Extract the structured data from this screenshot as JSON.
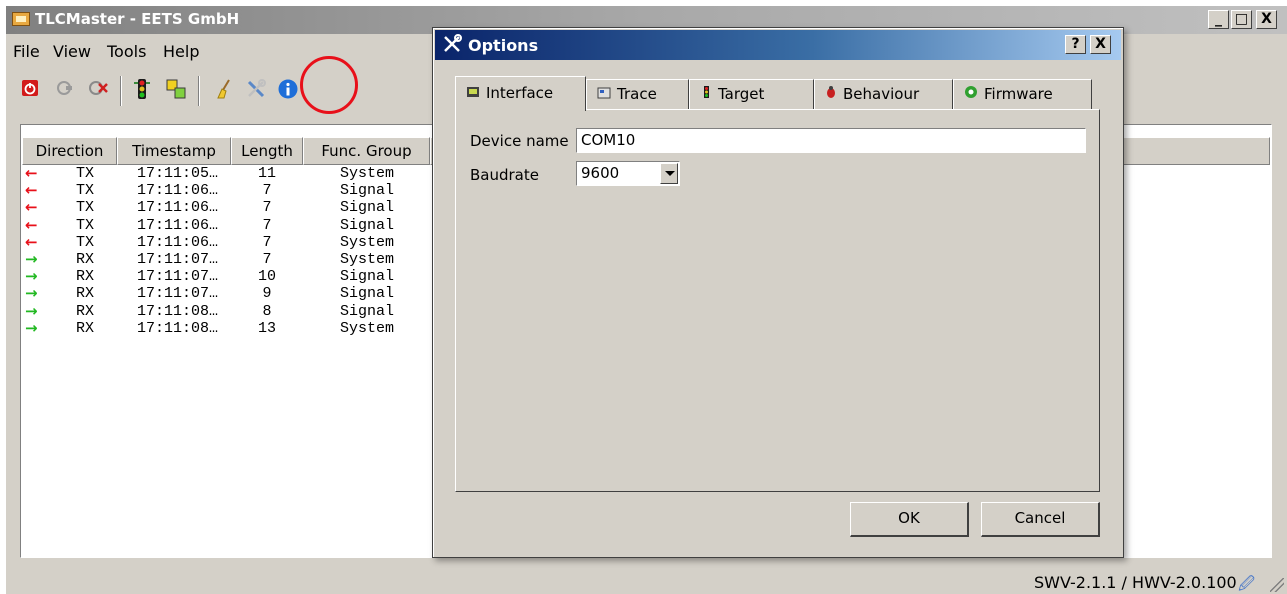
{
  "main_window": {
    "title": "TLCMaster - EETS GmbH",
    "caption_buttons": {
      "minimize": "_",
      "maximize": "□",
      "close": "X"
    }
  },
  "menu": {
    "file": "File",
    "view": "View",
    "tools": "Tools",
    "help": "Help"
  },
  "toolbar": {
    "icons": [
      "power-icon",
      "connect-icon",
      "disconnect-icon",
      "traffic-light-icon",
      "swap-icon",
      "clear-broom-icon",
      "options-wrench-icon",
      "info-icon"
    ],
    "highlighted": "options-wrench-icon",
    "highlight_color": "#e8101a"
  },
  "log_table": {
    "columns": [
      "Direction",
      "Timestamp",
      "Length",
      "Func. Group"
    ],
    "rows": [
      {
        "arrow": "←",
        "direction": "TX",
        "timestamp": "17:11:05…",
        "length": "11",
        "func_group": "System"
      },
      {
        "arrow": "←",
        "direction": "TX",
        "timestamp": "17:11:06…",
        "length": "7",
        "func_group": "Signal"
      },
      {
        "arrow": "←",
        "direction": "TX",
        "timestamp": "17:11:06…",
        "length": "7",
        "func_group": "Signal"
      },
      {
        "arrow": "←",
        "direction": "TX",
        "timestamp": "17:11:06…",
        "length": "7",
        "func_group": "Signal"
      },
      {
        "arrow": "←",
        "direction": "TX",
        "timestamp": "17:11:06…",
        "length": "7",
        "func_group": "System"
      },
      {
        "arrow": "→",
        "direction": "RX",
        "timestamp": "17:11:07…",
        "length": "7",
        "func_group": "System"
      },
      {
        "arrow": "→",
        "direction": "RX",
        "timestamp": "17:11:07…",
        "length": "10",
        "func_group": "Signal"
      },
      {
        "arrow": "→",
        "direction": "RX",
        "timestamp": "17:11:07…",
        "length": "9",
        "func_group": "Signal"
      },
      {
        "arrow": "→",
        "direction": "RX",
        "timestamp": "17:11:08…",
        "length": "8",
        "func_group": "Signal"
      },
      {
        "arrow": "→",
        "direction": "RX",
        "timestamp": "17:11:08…",
        "length": "13",
        "func_group": "System"
      }
    ],
    "colors": {
      "tx": "#e8101a",
      "rx": "#22b822"
    }
  },
  "status": {
    "version": "SWV-2.1.1 / HWV-2.0.100"
  },
  "options_dialog": {
    "title": "Options",
    "help_button": "?",
    "close_button": "X",
    "tabs": [
      {
        "label": "Interface",
        "icon": "interface-icon"
      },
      {
        "label": "Trace",
        "icon": "trace-icon"
      },
      {
        "label": "Target",
        "icon": "traffic-light-icon"
      },
      {
        "label": "Behaviour",
        "icon": "behaviour-icon"
      },
      {
        "label": "Firmware",
        "icon": "firmware-icon"
      }
    ],
    "active_tab": "Interface",
    "device_name_label": "Device name",
    "device_name_value": "COM10",
    "baudrate_label": "Baudrate",
    "baudrate_value": "9600",
    "ok_label": "OK",
    "cancel_label": "Cancel"
  }
}
